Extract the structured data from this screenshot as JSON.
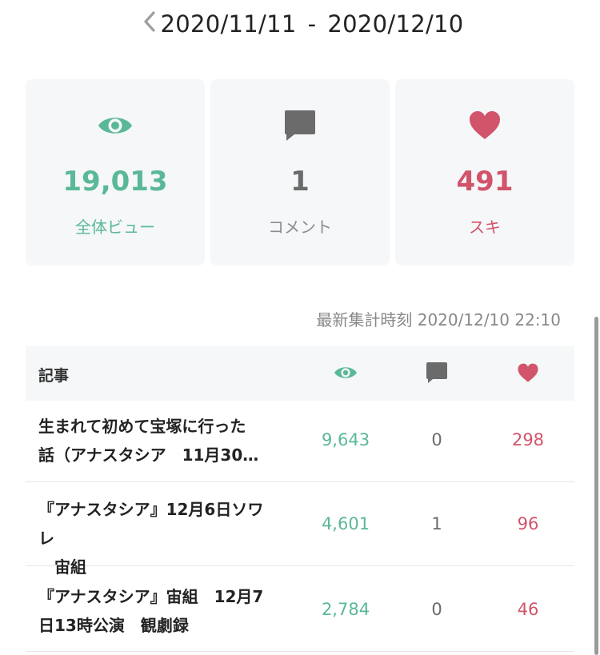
{
  "header": {
    "start_date": "2020/11/11",
    "separator": "-",
    "end_date": "2020/12/10"
  },
  "stats": {
    "views": {
      "value": "19,013",
      "label": "全体ビュー",
      "icon": "eye-icon",
      "color": "#5ab898"
    },
    "comments": {
      "value": "1",
      "label": "コメント",
      "icon": "comment-icon",
      "color": "#6b6b6b"
    },
    "likes": {
      "value": "491",
      "label": "スキ",
      "icon": "heart-icon",
      "color": "#d2546a"
    }
  },
  "updated_text": "最新集計時刻 2020/12/10 22:10",
  "table": {
    "header_title": "記事",
    "rows": [
      {
        "title_line1": "生まれて初めて宝塚に行った",
        "title_line2": "話（アナスタシア　11月30…",
        "views": "9,643",
        "comments": "0",
        "likes": "298"
      },
      {
        "title_line1": "『アナスタシア』12月6日ソワレ",
        "title_line2": "　宙組",
        "views": "4,601",
        "comments": "1",
        "likes": "96"
      },
      {
        "title_line1": "『アナスタシア』宙組　12月7",
        "title_line2": "日13時公演　観劇録",
        "views": "2,784",
        "comments": "0",
        "likes": "46"
      }
    ]
  }
}
